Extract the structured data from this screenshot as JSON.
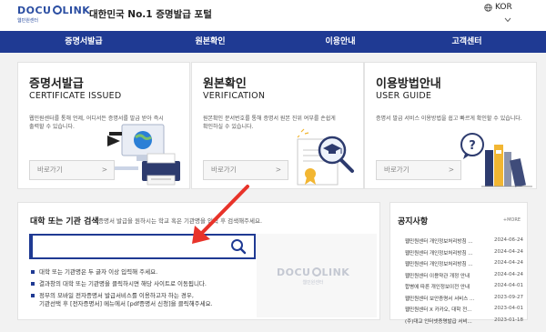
{
  "header": {
    "logo_main_left": "DOCU",
    "logo_main_right": "LINK",
    "logo_sub": "웹민원센터",
    "site_title": "대한민국 No.1 증명발급 포털",
    "language": "KOR"
  },
  "nav": [
    "증명서발급",
    "원본확인",
    "이용안내",
    "고객센터"
  ],
  "cards": [
    {
      "title": "증명서발급",
      "subtitle": "CERTIFICATE ISSUED",
      "desc": "웹민원센터를 통해 언제, 어디서든 증명서를 발급 받아 즉시출력할 수 있습니다.",
      "button": "바로가기",
      "button_arrow": ">",
      "icon": "printer-globe-icon"
    },
    {
      "title": "원본확인",
      "subtitle": "VERIFICATION",
      "desc": "원본확인 문서번호를 통해 증명서 원본 진위 여부를 손쉽게 확인하실 수 있습니다.",
      "button": "바로가기",
      "button_arrow": ">",
      "icon": "certificate-magnifier-icon"
    },
    {
      "title": "이용방법안내",
      "subtitle": "USER GUIDE",
      "desc": "증명서 발급 서비스 이용방법을 쉽고 빠르게 확인할 수 있습니다.",
      "button": "바로가기",
      "button_arrow": ">",
      "icon": "books-question-icon"
    }
  ],
  "search": {
    "title": "대학 또는 기관 검색",
    "hint": "증명서 발급을 원하시는 학교 혹은 기관명을 입력 후 검색해주세요.",
    "input_value": "",
    "placeholder": "",
    "bullets": [
      {
        "text": "대학 또는 기관명은 두 글자 이상 입력해 주세요.",
        "sub": ""
      },
      {
        "text": "결과창의 대학 또는 기관명을 클릭하시면 해당 사이트로 이동됩니다.",
        "sub": ""
      },
      {
        "text": "정부의 모바일 전자증명서 발급서비스를 이용하고자 하는 경우,",
        "sub": "기관선택 후 [전자증명서] 메뉴에서 [pdf증명서 신청]을 클릭해주세요."
      }
    ],
    "watermark_main_left": "DOCU",
    "watermark_main_right": "LINK",
    "watermark_sub": "웹민원센터"
  },
  "notice": {
    "title": "공지사항",
    "more": "+MORE",
    "items": [
      {
        "title": "웹민원센터 개인정보처리방침 ...",
        "date": "2024-06-24"
      },
      {
        "title": "웹민원센터 개인정보처리방침 ...",
        "date": "2024-04-24"
      },
      {
        "title": "웹민원센터 개인정보처리방침 ...",
        "date": "2024-04-24"
      },
      {
        "title": "웹민원센터 이용약관 개정 안내",
        "date": "2024-04-24"
      },
      {
        "title": "합병에 따른 개인정보이전 안내",
        "date": "2024-04-01"
      },
      {
        "title": "웹민원센터 보안증명서 서비스 ...",
        "date": "2023-09-27"
      },
      {
        "title": "웹민원센터 X 카카오, 대학 전...",
        "date": "2023-04-01"
      },
      {
        "title": "(주)대교 인터넷증명발급 서비...",
        "date": "2023-01-18"
      }
    ]
  },
  "colors": {
    "nav_bg": "#1f3a93",
    "brand": "#2b4ea2",
    "arrow": "#e8332a",
    "page_bg": "#f2f2f2"
  }
}
